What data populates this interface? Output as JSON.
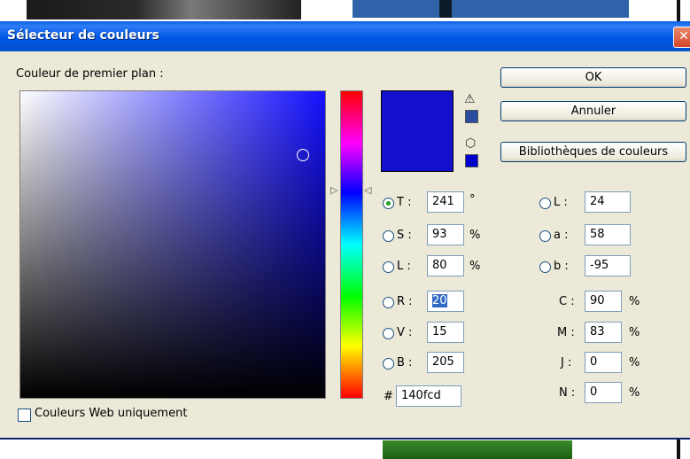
{
  "dialog": {
    "title": "Sélecteur de couleurs",
    "close_label": "✕",
    "foreground_label": "Couleur de premier plan :",
    "web_only_label": "Couleurs Web uniquement",
    "current_color": "#140fcd"
  },
  "buttons": {
    "ok": "OK",
    "cancel": "Annuler",
    "libraries": "Bibliothèques de couleurs"
  },
  "icons": {
    "gamut_warning": "⚠",
    "web_safe": "⬡"
  },
  "hsb": {
    "h": {
      "label": "T :",
      "value": "241",
      "unit": "°"
    },
    "s": {
      "label": "S :",
      "value": "93",
      "unit": "%"
    },
    "b": {
      "label": "L :",
      "value": "80",
      "unit": "%"
    }
  },
  "rgb": {
    "r": {
      "label": "R :",
      "value": "20"
    },
    "g": {
      "label": "V :",
      "value": "15"
    },
    "b": {
      "label": "B :",
      "value": "205"
    }
  },
  "hex": {
    "label": "#",
    "value": "140fcd"
  },
  "lab": {
    "l": {
      "label": "L :",
      "value": "24"
    },
    "a": {
      "label": "a :",
      "value": "58"
    },
    "b": {
      "label": "b :",
      "value": "-95"
    }
  },
  "cmyk": {
    "c": {
      "label": "C :",
      "value": "90",
      "unit": "%"
    },
    "m": {
      "label": "M :",
      "value": "83",
      "unit": "%"
    },
    "y": {
      "label": "J :",
      "value": "0",
      "unit": "%"
    },
    "k": {
      "label": "N :",
      "value": "0",
      "unit": "%"
    }
  }
}
